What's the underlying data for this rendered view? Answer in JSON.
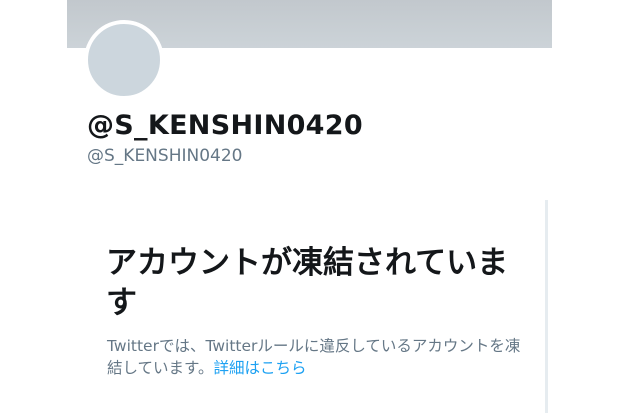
{
  "profile": {
    "display_name": "@S_KENSHIN0420",
    "screen_name": "@S_KENSHIN0420"
  },
  "notice": {
    "title": "アカウントが凍結されています",
    "body": "Twitterでは、Twitterルールに違反しているアカウントを凍結しています。",
    "link_label": "詳細はこちら"
  },
  "colors": {
    "link": "#1da1f2",
    "secondary_text": "#657786",
    "banner": "#c2c8cd",
    "avatar": "#ccd6dd"
  }
}
